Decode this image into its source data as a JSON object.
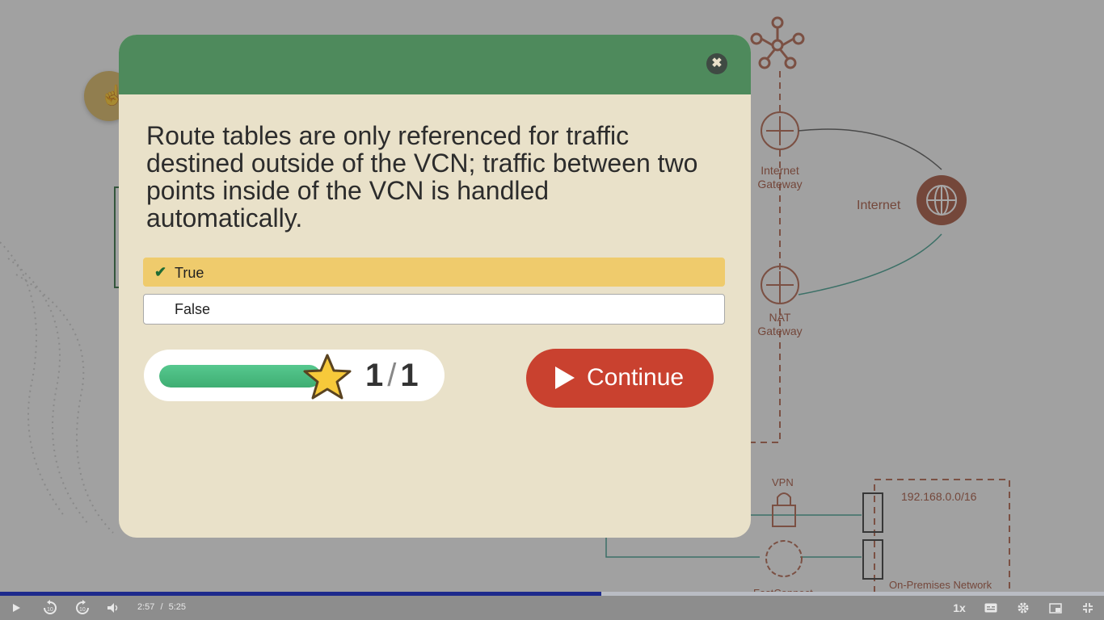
{
  "background": {
    "diagram_labels": {
      "internet_gateway": "Internet\nGateway",
      "nat_gateway": "NAT\nGateway",
      "internet": "Internet",
      "vpn": "VPN",
      "cidr": "192.168.0.0/16",
      "fastconnect": "FastConnect",
      "on_premises": "On-Premises Network"
    }
  },
  "quiz": {
    "close_icon": "close-icon",
    "question": "Route tables are only referenced for traffic destined outside of the VCN; traffic between two points inside of the VCN is handled automatically.",
    "options": [
      {
        "label": "True",
        "selected": true
      },
      {
        "label": "False",
        "selected": false
      }
    ],
    "score": {
      "current": "1",
      "total": "1",
      "progress": 1.0
    },
    "continue_label": "Continue"
  },
  "player": {
    "current_time": "2:57",
    "separator": "/",
    "duration": "5:25",
    "played_fraction": 0.545,
    "speed": "1x"
  },
  "colors": {
    "header": "#4e8a5c",
    "modal_bg": "#e9e1c9",
    "selected_option": "#efcb6c",
    "continue": "#c9412f",
    "progress": "#3fae73"
  }
}
